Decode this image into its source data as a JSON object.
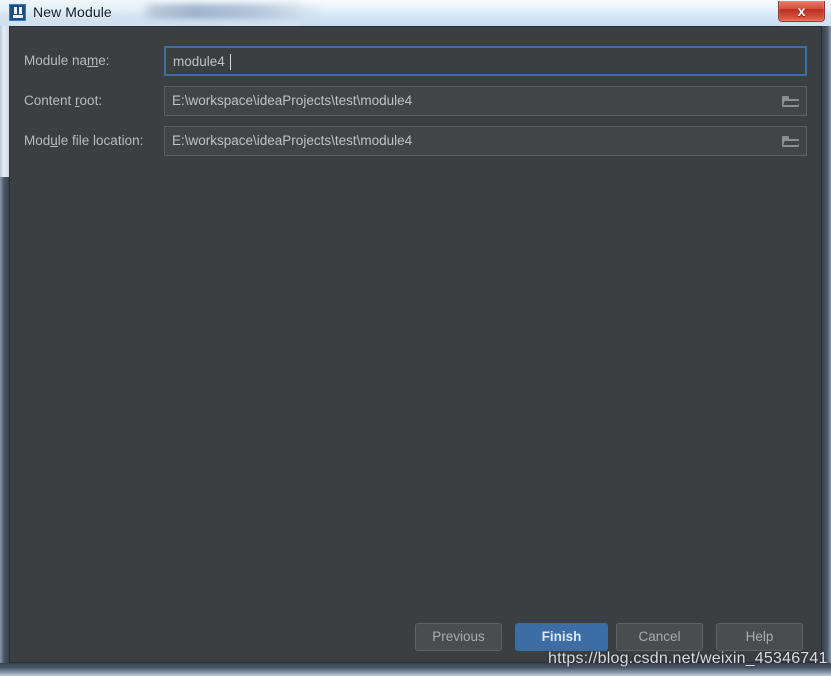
{
  "window": {
    "title": "New Module",
    "app_icon": "intellij-idea-icon",
    "close_label": "x",
    "accent_blue": "#3d6da5",
    "content_bg": "#3c3f41",
    "field_bg": "#45494a",
    "label_color": "#bbbbbb"
  },
  "form": {
    "fields": [
      {
        "label_pre": "Module na",
        "label_mnemonic": "m",
        "label_post": "e:",
        "value": "module4",
        "focused": true,
        "has_browse": false
      },
      {
        "label_pre": "Content ",
        "label_mnemonic": "r",
        "label_post": "oot:",
        "value": "E:\\workspace\\ideaProjects\\test\\module4",
        "focused": false,
        "has_browse": true,
        "browse_icon": "folder-icon"
      },
      {
        "label_pre": "Mod",
        "label_mnemonic": "u",
        "label_post": "le file location:",
        "value": "E:\\workspace\\ideaProjects\\test\\module4",
        "focused": false,
        "has_browse": true,
        "browse_icon": "folder-icon"
      }
    ]
  },
  "buttons": {
    "previous": "Previous",
    "finish": "Finish",
    "cancel": "Cancel",
    "help": "Help"
  },
  "watermark": {
    "text": "https://blog.csdn.net/weixin_45346741"
  }
}
